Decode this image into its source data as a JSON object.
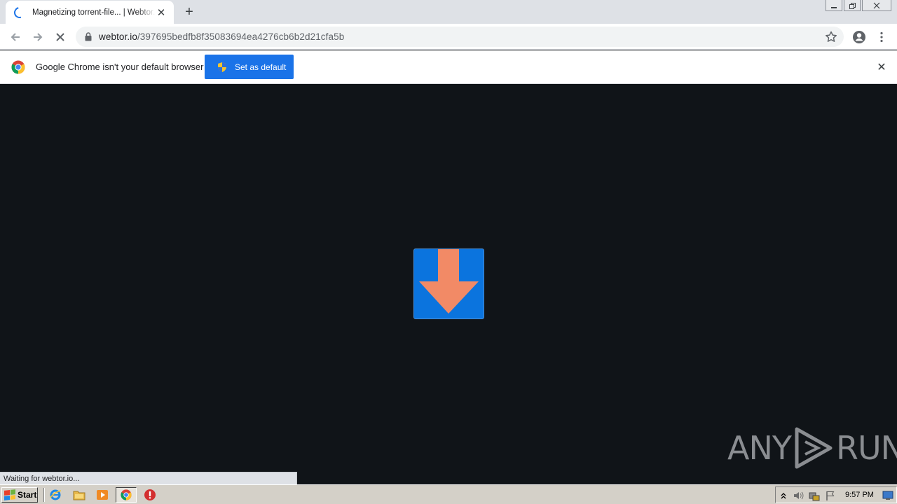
{
  "browser": {
    "tab": {
      "title": "Magnetizing torrent-file... | Webtor.io",
      "close_glyph": "✕"
    },
    "new_tab_glyph": "+",
    "window_controls": [
      "minimize-icon",
      "restore-icon",
      "close-icon"
    ],
    "omnibox": {
      "url_host": "webtor.io",
      "url_path": "/397695bedfb8f35083694ea4276cb6b2d21cfa5b"
    },
    "toolbar_icons": [
      "back-arrow-icon",
      "forward-arrow-icon",
      "stop-loading-icon",
      "lock-icon",
      "star-icon",
      "profile-icon",
      "menu-icon"
    ]
  },
  "infobar": {
    "message": "Google Chrome isn't your default browser",
    "button_label": "Set as default",
    "close_glyph": "✕"
  },
  "page": {
    "loader_icon": "download-arrow-icon",
    "colors": {
      "background": "#101418",
      "loader_box": "#0b74de",
      "loader_arrow": "#f28a66"
    }
  },
  "status_bar": {
    "text": "Waiting for webtor.io..."
  },
  "watermark": {
    "text_left": "ANY",
    "text_right": "RUN"
  },
  "taskbar": {
    "start_label": "Start",
    "quick_launch": [
      "internet-explorer-icon",
      "folder-icon",
      "media-player-icon",
      "chrome-icon",
      "stop-sign-icon"
    ],
    "tray_icons": [
      "tray-chevron-icon",
      "volume-icon",
      "network-icon",
      "flag-icon",
      "show-desktop-icon"
    ],
    "clock": "9:57 PM"
  }
}
